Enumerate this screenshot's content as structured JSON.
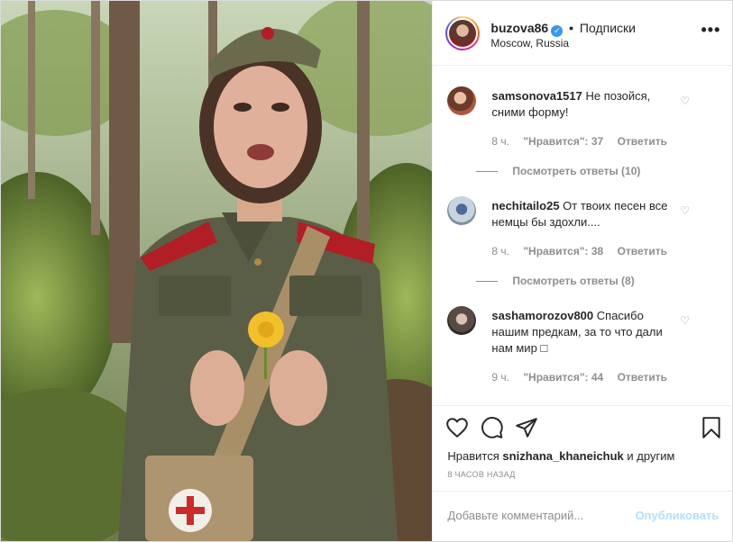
{
  "header": {
    "username": "buzova86",
    "verified_icon": "verified-badge-icon",
    "separator": "•",
    "follow_label": "Подписки",
    "location": "Moscow, Russia",
    "more_icon": "more-options-icon",
    "more_label": "•••"
  },
  "comments": [
    {
      "username": "samsonova1517",
      "text": "Не позойся, сними форму!",
      "time": "8 ч.",
      "likes": "\"Нравится\": 37",
      "reply": "Ответить",
      "view_replies": "Посмотреть ответы (10)"
    },
    {
      "username": "nechitailo25",
      "text": "От твоих песен все немцы бы здохли....",
      "time": "8 ч.",
      "likes": "\"Нравится\": 38",
      "reply": "Ответить",
      "view_replies": "Посмотреть ответы (8)"
    },
    {
      "username": "sashamorozov800",
      "text": "Спасибо нашим предкам, за то что дали нам мир □",
      "time": "9 ч.",
      "likes": "\"Нравится\": 44",
      "reply": "Ответить",
      "view_replies": ""
    }
  ],
  "actions": {
    "like_icon": "heart-icon",
    "comment_icon": "comment-icon",
    "share_icon": "share-icon",
    "save_icon": "bookmark-icon",
    "liked_prefix": "Нравится",
    "liked_user": "snizhana_khaneichuk",
    "liked_suffix": "и другим",
    "time_ago": "8 ЧАСОВ НАЗАД"
  },
  "add_comment": {
    "placeholder": "Добавьте комментарий...",
    "post_label": "Опубликовать"
  },
  "colors": {
    "accent": "#3897f0",
    "post_disabled": "#b2dffc",
    "muted": "#8e8e8e"
  }
}
